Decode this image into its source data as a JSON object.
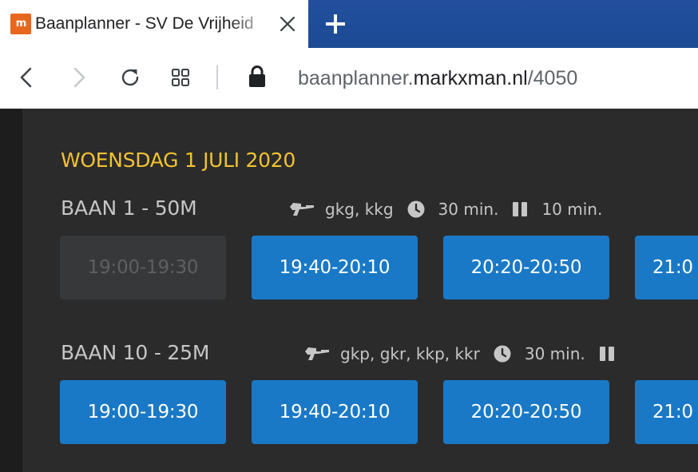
{
  "browser": {
    "tab": {
      "favicon_text": "m",
      "title": "Baanplanner - SV De Vrijheid"
    },
    "url": {
      "subdomain": "baanplanner.",
      "host": "markxman.nl",
      "path": "/4050"
    }
  },
  "page": {
    "date_heading": "WOENSDAG 1 JULI 2020",
    "lanes": [
      {
        "title": "BAAN 1 - 50M",
        "weapons": "gkg, kkg",
        "duration": "30 min.",
        "pause": "10 min.",
        "slots": [
          {
            "label": "19:00-19:30",
            "available": false
          },
          {
            "label": "19:40-20:10",
            "available": true
          },
          {
            "label": "20:20-20:50",
            "available": true
          },
          {
            "label": "21:0",
            "available": true
          }
        ]
      },
      {
        "title": "BAAN 10 - 25M",
        "weapons": "gkp, gkr, kkp, kkr",
        "duration": "30 min.",
        "pause": "",
        "slots": [
          {
            "label": "19:00-19:30",
            "available": true
          },
          {
            "label": "19:40-20:10",
            "available": true
          },
          {
            "label": "20:20-20:50",
            "available": true
          },
          {
            "label": "21:0",
            "available": true
          }
        ]
      }
    ]
  },
  "colors": {
    "accent": "#f2c230",
    "slot_available": "#1a79c7",
    "slot_unavailable": "#363839",
    "tabstrip": "#1f4d9a"
  }
}
